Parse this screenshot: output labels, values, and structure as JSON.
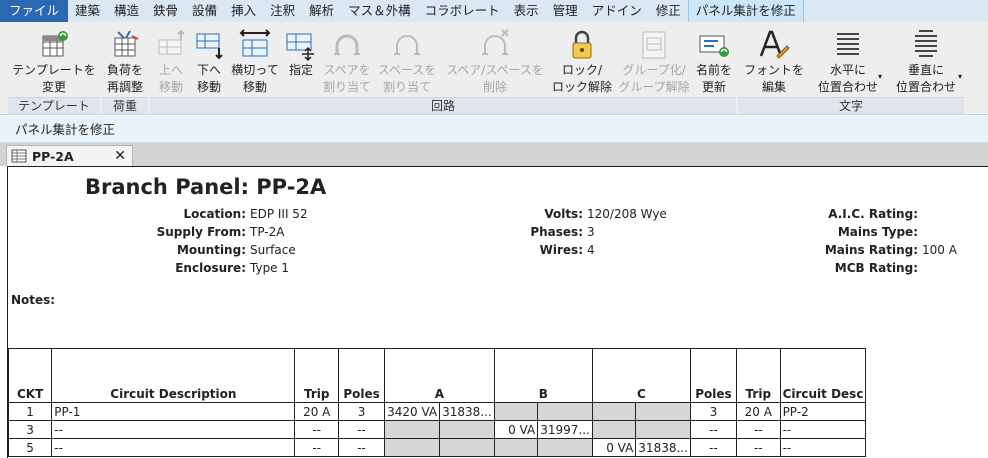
{
  "menu": {
    "tabs": [
      "ファイル",
      "建築",
      "構造",
      "鉄骨",
      "設備",
      "挿入",
      "注釈",
      "解析",
      "マス＆外構",
      "コラボレート",
      "表示",
      "管理",
      "アドイン",
      "修正",
      "パネル集計を修正"
    ]
  },
  "ribbon": {
    "buttons": [
      {
        "line1": "テンプレートを",
        "line2": "変更",
        "icon": "template-icon"
      },
      {
        "line1": "負荷を",
        "line2": "再調整",
        "icon": "rebalance-icon"
      },
      {
        "line1": "上へ",
        "line2": "移動",
        "icon": "move-up-icon"
      },
      {
        "line1": "下へ",
        "line2": "移動",
        "icon": "move-down-icon"
      },
      {
        "line1": "横切って",
        "line2": "移動",
        "icon": "move-across-icon"
      },
      {
        "line1": "指定",
        "line2": "",
        "icon": "assign-icon"
      },
      {
        "line1": "スペアを",
        "line2": "割り当て",
        "icon": "spare-icon"
      },
      {
        "line1": "スペースを",
        "line2": "割り当て",
        "icon": "space-icon"
      },
      {
        "line1": "スペア/スペースを",
        "line2": "削除",
        "icon": "remove-spare-icon"
      },
      {
        "line1": "ロック/",
        "line2": "ロック解除",
        "icon": "lock-icon"
      },
      {
        "line1": "グループ化/",
        "line2": "グループ解除",
        "icon": "group-icon"
      },
      {
        "line1": "名前を",
        "line2": "更新",
        "icon": "update-names-icon"
      },
      {
        "line1": "フォントを",
        "line2": "編集",
        "icon": "font-icon"
      },
      {
        "line1": "水平に",
        "line2": "位置合わせ",
        "icon": "align-horizontal-icon"
      },
      {
        "line1": "垂直に",
        "line2": "位置合わせ",
        "icon": "align-vertical-icon"
      }
    ],
    "panels": [
      "テンプレート",
      "荷重",
      "回路",
      "文字"
    ]
  },
  "options_bar": {
    "label": "パネル集計を修正"
  },
  "document_tab": {
    "title": "PP-2A",
    "close": "✕"
  },
  "schedule": {
    "title": "Branch Panel: PP-2A",
    "info": {
      "location_label": "Location:",
      "location": "EDP III 52",
      "supply_label": "Supply From:",
      "supply": "TP-2A",
      "mounting_label": "Mounting:",
      "mounting": "Surface",
      "enclosure_label": "Enclosure:",
      "enclosure": "Type 1",
      "volts_label": "Volts:",
      "volts": "120/208 Wye",
      "phases_label": "Phases:",
      "phases": "3",
      "wires_label": "Wires:",
      "wires": "4",
      "aic_label": "A.I.C. Rating:",
      "aic": "",
      "mains_type_label": "Mains Type:",
      "mains_type": "",
      "mains_rating_label": "Mains Rating:",
      "mains_rating": "100 A",
      "mcb_label": "MCB Rating:",
      "mcb": ""
    },
    "notes_label": "Notes:",
    "columns": [
      "CKT",
      "Circuit Description",
      "Trip",
      "Poles",
      "A",
      "B",
      "C",
      "Poles",
      "Trip",
      "Circuit Desc"
    ],
    "rows": [
      {
        "ckt": "1",
        "desc": "PP-1",
        "trip": "20 A",
        "poles": "3",
        "a1": "3420 VA",
        "a2": "31838...",
        "b1": "",
        "b2": "",
        "c1": "",
        "c2": "",
        "poles_r": "3",
        "trip_r": "20 A",
        "desc_r": "PP-2"
      },
      {
        "ckt": "3",
        "desc": "--",
        "trip": "--",
        "poles": "--",
        "a1": "",
        "a2": "",
        "b1": "0 VA",
        "b2": "31997...",
        "c1": "",
        "c2": "",
        "poles_r": "--",
        "trip_r": "--",
        "desc_r": "--"
      },
      {
        "ckt": "5",
        "desc": "--",
        "trip": "--",
        "poles": "--",
        "a1": "",
        "a2": "",
        "b1": "",
        "b2": "",
        "c1": "0 VA",
        "c2": "31838...",
        "poles_r": "--",
        "trip_r": "--",
        "desc_r": "--"
      }
    ]
  },
  "colors": {
    "file_tab": "#2b68b3",
    "context_tab": "#cde6f7",
    "ribbon_bg": "#eeeeee",
    "accent_icon": "#2a6fb8",
    "green_icon": "#3a9a3a",
    "shaded_cell": "#d6d6d6"
  }
}
